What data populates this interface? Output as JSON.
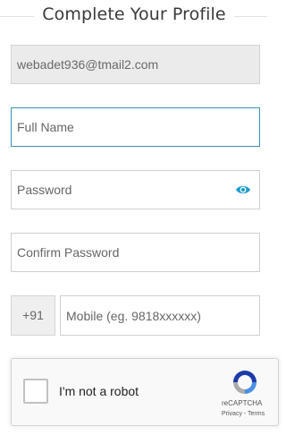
{
  "header": {
    "title": "Complete Your Profile"
  },
  "form": {
    "email_value": "webadet936@tmail2.com",
    "full_name_placeholder": "Full Name",
    "password_placeholder": "Password",
    "password_toggle_icon": "eye-icon",
    "confirm_password_placeholder": "Confirm Password",
    "country_code": "+91",
    "mobile_placeholder": "Mobile (eg. 9818xxxxxx)"
  },
  "captcha": {
    "label": "I'm not a robot",
    "brand": "reCAPTCHA",
    "links": "Privacy - Terms",
    "logo_icon": "recaptcha-logo-icon"
  },
  "colors": {
    "focus_border": "#3b8fb8",
    "eye_icon": "#1f9bd1",
    "readonly_bg": "#ebebeb"
  }
}
